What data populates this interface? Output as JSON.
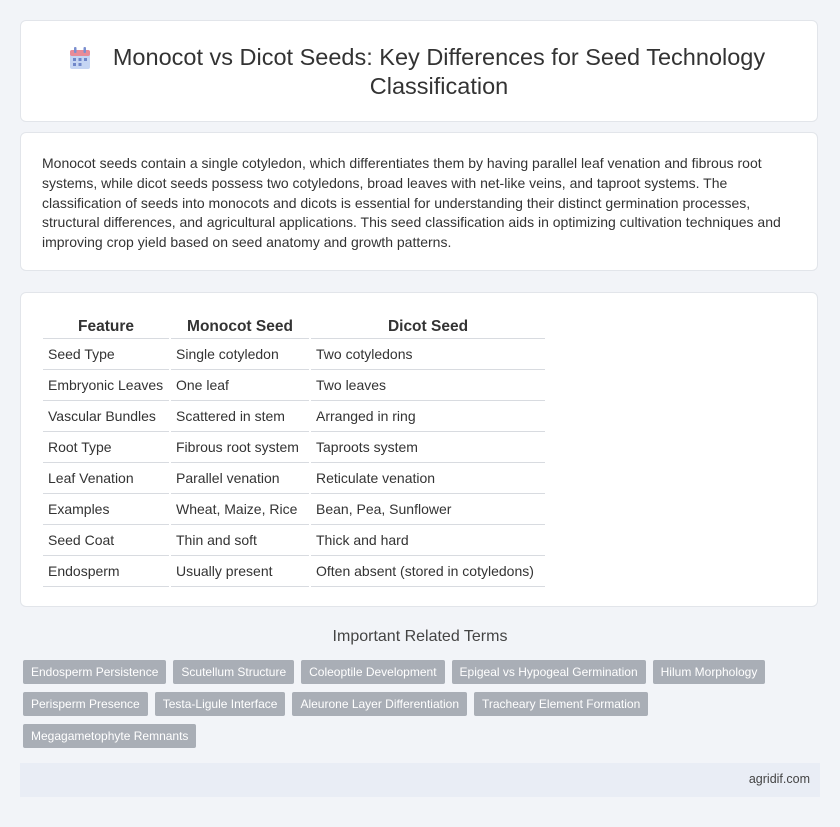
{
  "header": {
    "title": "Monocot vs Dicot Seeds: Key Differences for Seed Technology Classification",
    "icon": "calendar-icon",
    "icon_colors": {
      "top": "#e98b97",
      "body": "#9bb7e8",
      "cells": "#6f86c9"
    }
  },
  "intro": {
    "text": "Monocot seeds contain a single cotyledon, which differentiates them by having parallel leaf venation and fibrous root systems, while dicot seeds possess two cotyledons, broad leaves with net-like veins, and taproot systems. The classification of seeds into monocots and dicots is essential for understanding their distinct germination processes, structural differences, and agricultural applications. This seed classification aids in optimizing cultivation techniques and improving crop yield based on seed anatomy and growth patterns."
  },
  "table": {
    "headers": [
      "Feature",
      "Monocot Seed",
      "Dicot Seed"
    ],
    "rows": [
      [
        "Seed Type",
        "Single cotyledon",
        "Two cotyledons"
      ],
      [
        "Embryonic Leaves",
        "One leaf",
        "Two leaves"
      ],
      [
        "Vascular Bundles",
        "Scattered in stem",
        "Arranged in ring"
      ],
      [
        "Root Type",
        "Fibrous root system",
        "Taproots system"
      ],
      [
        "Leaf Venation",
        "Parallel venation",
        "Reticulate venation"
      ],
      [
        "Examples",
        "Wheat, Maize, Rice",
        "Bean, Pea, Sunflower"
      ],
      [
        "Seed Coat",
        "Thin and soft",
        "Thick and hard"
      ],
      [
        "Endosperm",
        "Usually present",
        "Often absent (stored in cotyledons)"
      ]
    ]
  },
  "related": {
    "heading": "Important Related Terms",
    "tags": [
      "Endosperm Persistence",
      "Scutellum Structure",
      "Coleoptile Development",
      "Epigeal vs Hypogeal Germination",
      "Hilum Morphology",
      "Perisperm Presence",
      "Testa-Ligule Interface",
      "Aleurone Layer Differentiation",
      "Tracheary Element Formation",
      "Megagametophyte Remnants"
    ]
  },
  "footer": {
    "site": "agridif.com"
  }
}
